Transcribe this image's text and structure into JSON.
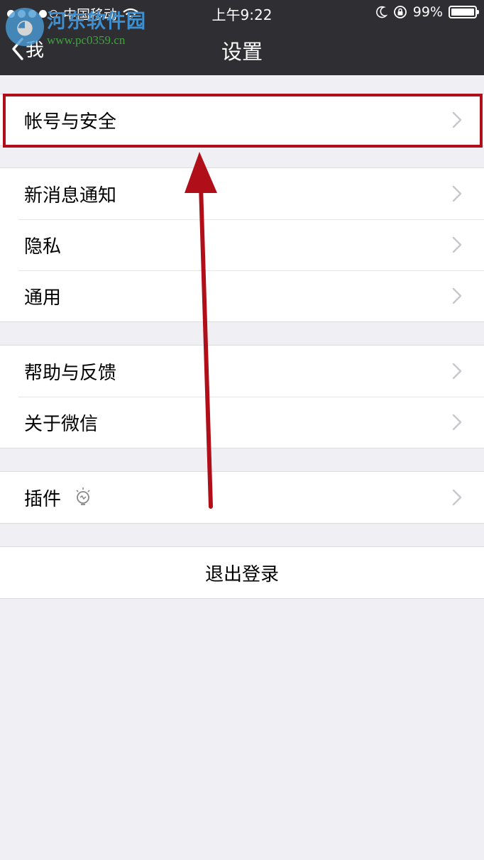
{
  "status_bar": {
    "carrier": "中国移动",
    "time": "上午9:22",
    "battery_percent": "99%",
    "battery_level": 0.99
  },
  "nav": {
    "back_label": "我",
    "title": "设置"
  },
  "watermark": {
    "name": "河东软件园",
    "url": "www.pc0359.cn"
  },
  "groups": [
    {
      "items": [
        {
          "label": "帐号与安全"
        }
      ]
    },
    {
      "items": [
        {
          "label": "新消息通知"
        },
        {
          "label": "隐私"
        },
        {
          "label": "通用"
        }
      ]
    },
    {
      "items": [
        {
          "label": "帮助与反馈"
        },
        {
          "label": "关于微信"
        }
      ]
    },
    {
      "items": [
        {
          "label": "插件"
        }
      ]
    }
  ],
  "logout_label": "退出登录",
  "colors": {
    "nav_background": "#2e2e33",
    "page_background": "#efeff4",
    "annotation_red": "#b00f1a"
  },
  "icons": {
    "back": "chevron-left-icon",
    "disclosure": "chevron-right-icon",
    "plugin_badge": "lightbulb-icon"
  }
}
